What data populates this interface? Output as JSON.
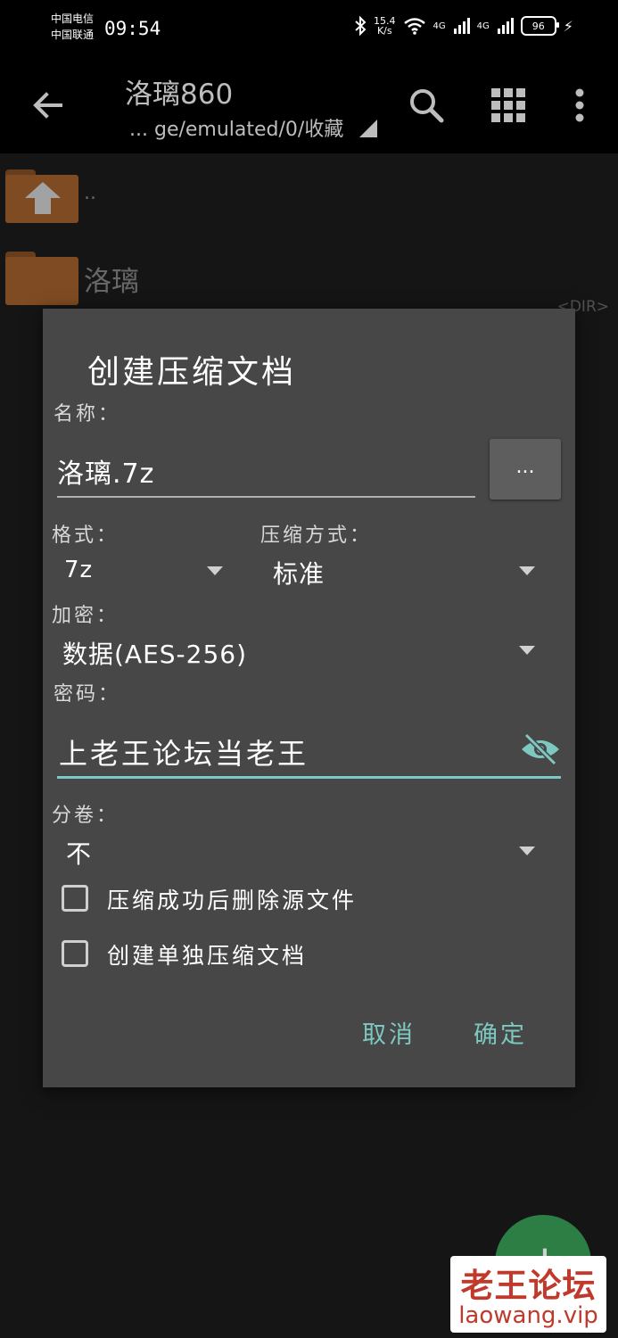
{
  "status_bar": {
    "carrier_1": "中国电信",
    "carrier_2": "中国联通",
    "time": "09:54",
    "speed_value": "15.4",
    "speed_unit": "K/s",
    "net_1": "4G",
    "net_2": "4G",
    "battery": "96",
    "icons": [
      "bluetooth-icon",
      "wifi-icon",
      "signal-icon",
      "battery-icon",
      "charging-icon"
    ]
  },
  "app_bar": {
    "title": "洛璃860",
    "path": "... ge/emulated/0/收藏",
    "icons": [
      "back-arrow-icon",
      "search-icon",
      "grid-view-icon",
      "more-vert-icon"
    ]
  },
  "files": [
    {
      "name": ".."
    },
    {
      "name": "洛璃",
      "tag": "<DIR>"
    }
  ],
  "dialog": {
    "title": "创建压缩文档",
    "name_label": "名称：",
    "name_value": "洛璃.7z",
    "browse_label": "...",
    "format_label": "格式：",
    "format_value": "7z",
    "method_label": "压缩方式：",
    "method_value": "标准",
    "encryption_label": "加密：",
    "encryption_value": "数据(AES-256)",
    "password_label": "密码：",
    "password_value": "上老王论坛当老王",
    "split_label": "分卷：",
    "split_value": "不",
    "checkbox_delete": "压缩成功后删除源文件",
    "checkbox_separate": "创建单独压缩文档",
    "cancel": "取消",
    "ok": "确定"
  },
  "accent_color": "#7dc8c0",
  "watermark": {
    "line1": "老王论坛",
    "line2": "laowang.vip"
  }
}
